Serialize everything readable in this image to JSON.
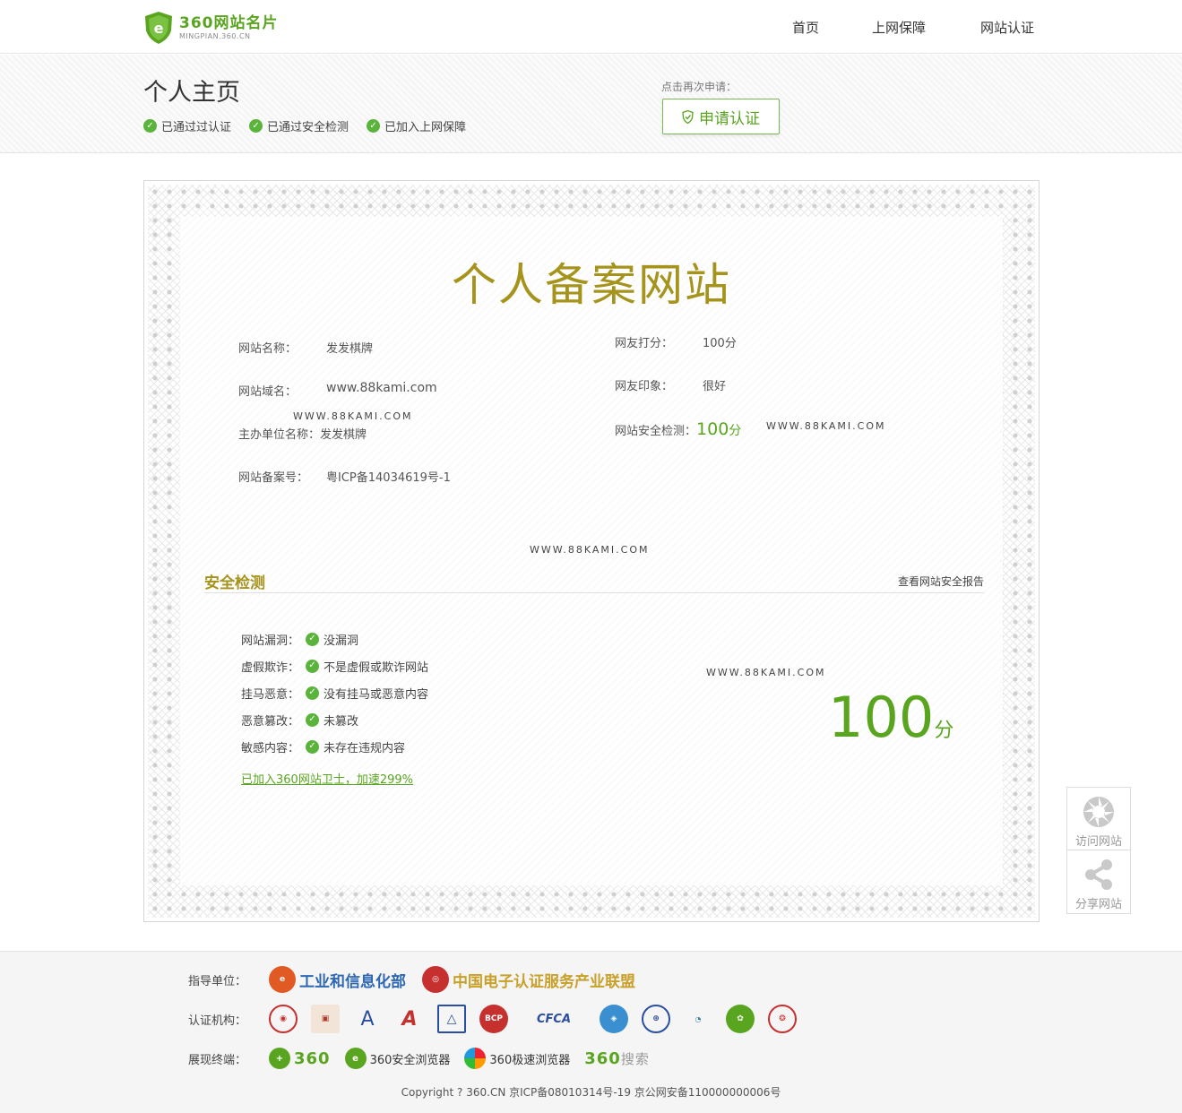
{
  "header": {
    "logo_main": "360网站名片",
    "logo_sub": "MINGPIAN.360.CN",
    "nav": [
      "首页",
      "上网保障",
      "网站认证"
    ]
  },
  "banner": {
    "title": "个人主页",
    "badges": [
      "已通过过认证",
      "已通过安全检测",
      "已加入上网保障"
    ],
    "reapply_hint": "点击再次申请：",
    "apply_label": "申请认证"
  },
  "certificate": {
    "title": "个人备案网站",
    "left": [
      {
        "key": "网站名称：",
        "value": "发发棋牌"
      },
      {
        "key": "网站域名：",
        "value": "www.88kami.com"
      },
      {
        "key": "主办单位名称：",
        "value": "发发棋牌"
      },
      {
        "key": "网站备案号：",
        "value": "粤ICP备14034619号-1"
      }
    ],
    "right": [
      {
        "key": "网友打分：",
        "value": "100分"
      },
      {
        "key": "网友印象：",
        "value": "很好"
      },
      {
        "key": "网站安全检测：",
        "score": "100",
        "unit": "分"
      }
    ],
    "watermark": "WWW.88KAMI.COM"
  },
  "security": {
    "title": "安全检测",
    "report_link": "查看网站安全报告",
    "items": [
      {
        "key": "网站漏洞：",
        "value": "没漏洞"
      },
      {
        "key": "虚假欺诈：",
        "value": "不是虚假或欺诈网站"
      },
      {
        "key": "挂马恶意：",
        "value": "没有挂马或恶意内容"
      },
      {
        "key": "恶意篡改：",
        "value": "未篡改"
      },
      {
        "key": "敏感内容：",
        "value": "未存在违规内容"
      }
    ],
    "joined_link": "已加入360网站卫士，加速299%",
    "score": "100",
    "score_unit": "分"
  },
  "float": {
    "visit": "访问网站",
    "share": "分享网站"
  },
  "footer": {
    "guide_label": "指导单位：",
    "org1": "工业和信息化部",
    "org2": "中国电子认证服务产业联盟",
    "cert_label": "认证机构：",
    "cfca": "CFCA",
    "terminal_label": "展现终端：",
    "terminals": [
      "360安全浏览器",
      "360极速浏览器"
    ],
    "term_360_logo": "360",
    "term_search": "搜索",
    "copyright": "Copyright ? 360.CN 京ICP备08010314号-19 京公网安备110000000006号"
  },
  "colors": {
    "brand_green": "#5aa520",
    "gold": "#a5931c"
  }
}
